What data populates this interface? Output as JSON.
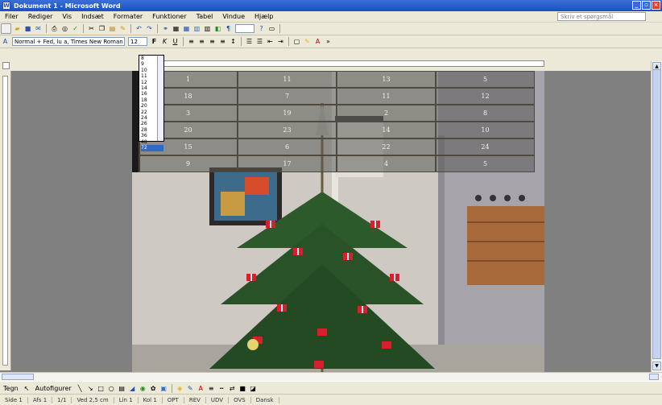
{
  "window": {
    "title": "Dokument 1 - Microsoft Word",
    "controls": [
      "_",
      "▫",
      "×"
    ]
  },
  "menu": {
    "items": [
      "Filer",
      "Rediger",
      "Vis",
      "Indsæt",
      "Formater",
      "Funktioner",
      "Tabel",
      "Vindue",
      "Hjælp"
    ],
    "help_placeholder": "Skriv et spørgsmål"
  },
  "toolbar2": {
    "style": "Normal + Fed, lu a, Times New Roman",
    "font_size": "12"
  },
  "font_sizes": [
    "8",
    "9",
    "10",
    "11",
    "12",
    "14",
    "16",
    "18",
    "20",
    "22",
    "24",
    "26",
    "28",
    "36",
    "48",
    "72"
  ],
  "font_size_selected": "72",
  "calendar_rows": [
    [
      "1",
      "11",
      "13",
      "5"
    ],
    [
      "18",
      "7",
      "11",
      "12"
    ],
    [
      "3",
      "19",
      "2",
      "8"
    ],
    [
      "20",
      "23",
      "14",
      "10"
    ],
    [
      "15",
      "6",
      "22",
      "24"
    ],
    [
      "9",
      "17",
      "4",
      "5"
    ]
  ],
  "drawbar": {
    "draw_label": "Tegn",
    "autoshapes_label": "Autofigurer"
  },
  "status": [
    "Side 1",
    "Afs 1",
    "1/1",
    "Ved 2,5 cm",
    "Lin 1",
    "Kol 1",
    "OPT",
    "REV",
    "UDV",
    "OVS",
    "Dansk"
  ],
  "colors": {
    "titlebar": "#1d4fc0",
    "chrome": "#ece9d8",
    "background": "#808080",
    "selection": "#316ac5"
  }
}
